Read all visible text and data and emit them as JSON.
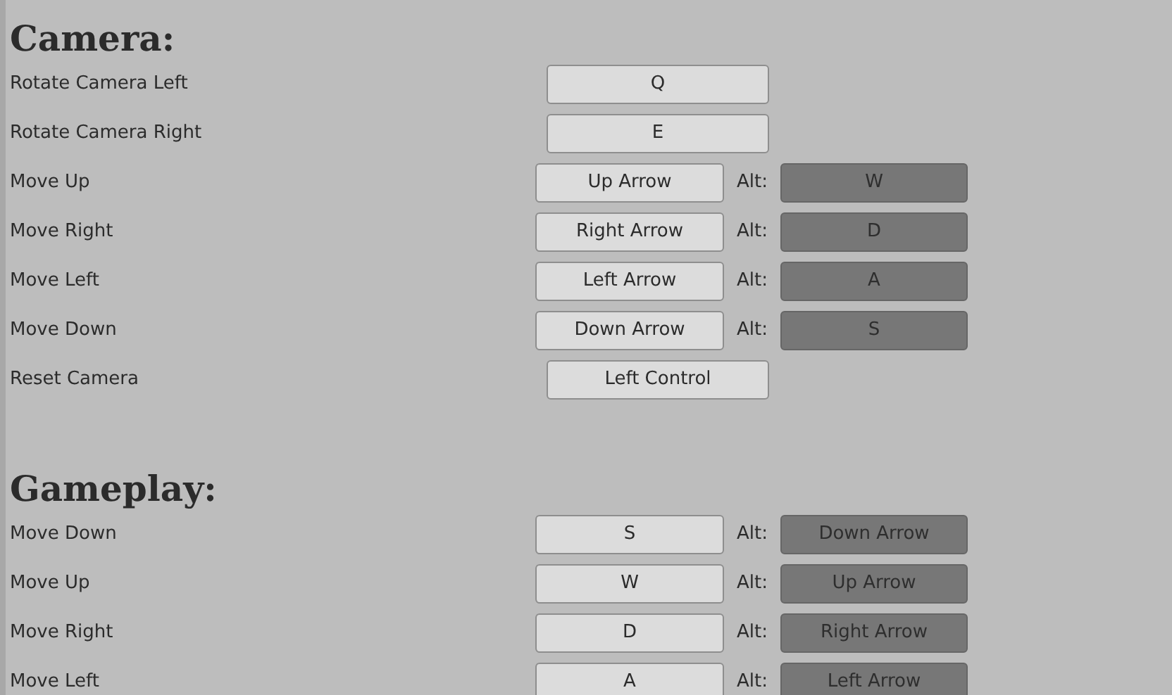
{
  "sections": [
    {
      "title": "Camera:",
      "rows": [
        {
          "kind": "single",
          "action": "Rotate Camera Left",
          "key": "Q"
        },
        {
          "kind": "single",
          "action": "Rotate Camera Right",
          "key": "E"
        },
        {
          "kind": "alt",
          "action": "Move Up",
          "key": "Up Arrow",
          "alt_label": "Alt:",
          "alt_key": "W"
        },
        {
          "kind": "alt",
          "action": "Move Right",
          "key": "Right Arrow",
          "alt_label": "Alt:",
          "alt_key": "D"
        },
        {
          "kind": "alt",
          "action": "Move Left",
          "key": "Left Arrow",
          "alt_label": "Alt:",
          "alt_key": "A"
        },
        {
          "kind": "alt",
          "action": "Move Down",
          "key": "Down Arrow",
          "alt_label": "Alt:",
          "alt_key": "S"
        },
        {
          "kind": "single",
          "action": "Reset Camera",
          "key": "Left Control"
        }
      ]
    },
    {
      "title": "Gameplay:",
      "rows": [
        {
          "kind": "alt",
          "action": "Move Down",
          "key": "S",
          "alt_label": "Alt:",
          "alt_key": "Down Arrow"
        },
        {
          "kind": "alt",
          "action": "Move Up",
          "key": "W",
          "alt_label": "Alt:",
          "alt_key": "Up Arrow"
        },
        {
          "kind": "alt",
          "action": "Move Right",
          "key": "D",
          "alt_label": "Alt:",
          "alt_key": "Right Arrow"
        },
        {
          "kind": "alt",
          "action": "Move Left",
          "key": "A",
          "alt_label": "Alt:",
          "alt_key": "Left Arrow"
        }
      ]
    }
  ]
}
